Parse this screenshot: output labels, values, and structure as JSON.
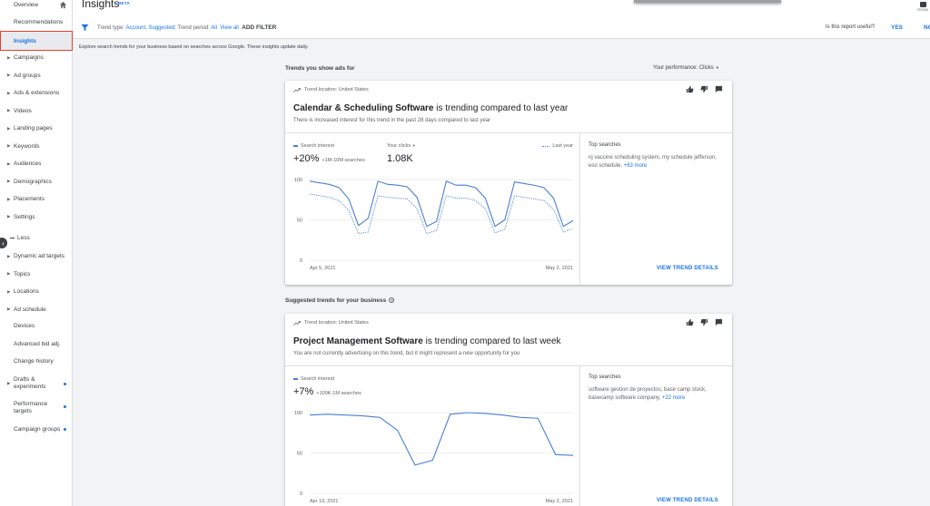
{
  "sidebar": {
    "overview": "Overview",
    "recommendations": "Recommendations",
    "insights": "Insights",
    "items": [
      "Campaigns",
      "Ad groups",
      "Ads & extensions",
      "Videos",
      "Landing pages",
      "Keywords",
      "Audiences",
      "Demographics",
      "Placements",
      "Settings"
    ],
    "less": "Less",
    "more_items": [
      "Dynamic ad targets",
      "Topics",
      "Locations",
      "Ad schedule"
    ],
    "plain_items": [
      "Devices",
      "Advanced bid adj.",
      "Change history"
    ],
    "drafts": "Drafts & experiments",
    "performance_targets": "Performance targets",
    "campaign_groups": "Campaign groups"
  },
  "header": {
    "title": "Insights",
    "beta": "BETA",
    "feedback": "FEEDB"
  },
  "filters": {
    "trend_type_label": "Trend type:",
    "trend_type_value": "Account, Suggested;",
    "trend_period_label": "Trend period:",
    "trend_period_value": "All",
    "view_all": "View all",
    "add_filter": "ADD FILTER",
    "useful_question": "Is this report useful?",
    "yes": "YES",
    "no": "NO"
  },
  "description": "Explore search trends for your business based on searches across Google. These insights update daily.",
  "section1": {
    "title": "Trends you show ads for",
    "performance_label": "Your performance:",
    "performance_value": "Clicks"
  },
  "card1": {
    "location": "Trend location: United States",
    "title_bold": "Calendar & Scheduling Software",
    "title_rest": " is trending compared to last year",
    "subtitle": "There is increased interest for this trend in the past 28 days compared to last year",
    "legend_search": "Search interest",
    "legend_clicks": "Your clicks",
    "legend_last_year": "Last year",
    "metric_main": "+20%",
    "metric_sub": "+1M-10M searches",
    "clicks_value": "1.08K",
    "top_searches_label": "Top searches",
    "top_searches": "nj vaccine scheduling system, my schedule jefferson, eso schedule, ",
    "top_searches_more": "+63 more",
    "view_details": "VIEW TREND DETAILS"
  },
  "section2": {
    "title": "Suggested trends for your business"
  },
  "card2": {
    "location": "Trend location: United States",
    "title_bold": "Project Management Software",
    "title_rest": " is trending compared to last week",
    "subtitle": "You are not currently advertising on this trend, but it might represent a new opportunity for you",
    "legend_search": "Search interest",
    "metric_main": "+7%",
    "metric_sub": "+100K-1M searches",
    "top_searches_label": "Top searches",
    "top_searches": "software gestion de proyectos, base camp stock, basecamp software company, ",
    "top_searches_more": "+22 more",
    "view_details": "VIEW TREND DETAILS"
  },
  "chart_data": [
    {
      "type": "line",
      "yticks": [
        0,
        50,
        100
      ],
      "ylim": [
        0,
        100
      ],
      "x_start_label": "Apr 5, 2021",
      "x_end_label": "May 2, 2021",
      "series": [
        {
          "name": "Search interest",
          "style": "solid",
          "color": "#4a7fd6",
          "values": [
            98,
            96,
            94,
            90,
            76,
            43,
            52,
            98,
            94,
            93,
            91,
            78,
            42,
            48,
            98,
            93,
            93,
            90,
            77,
            42,
            50,
            97,
            95,
            93,
            90,
            77,
            42,
            49
          ]
        },
        {
          "name": "Last year",
          "style": "dotted",
          "color": "#4a7fd6",
          "values": [
            82,
            80,
            78,
            74,
            62,
            33,
            35,
            80,
            78,
            77,
            76,
            64,
            33,
            37,
            80,
            77,
            77,
            74,
            64,
            34,
            38,
            80,
            78,
            76,
            74,
            63,
            35,
            39
          ]
        }
      ]
    },
    {
      "type": "line",
      "yticks": [
        0,
        50,
        100
      ],
      "ylim": [
        0,
        100
      ],
      "x_start_label": "Apr 19, 2021",
      "x_end_label": "May 2, 2021",
      "series": [
        {
          "name": "Search interest",
          "style": "solid",
          "color": "#4a7fd6",
          "values": [
            97,
            98,
            97,
            96,
            94,
            78,
            35,
            41,
            98,
            100,
            99,
            97,
            94,
            93,
            48,
            47
          ]
        }
      ]
    }
  ]
}
